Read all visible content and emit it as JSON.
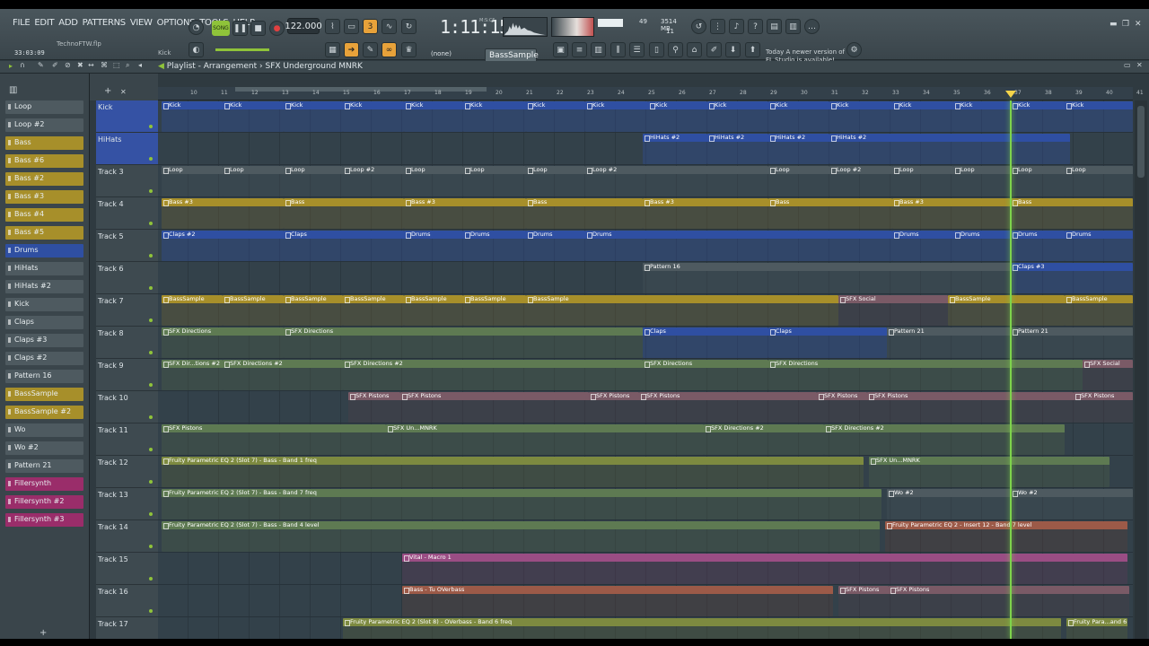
{
  "menu": [
    "FILE",
    "EDIT",
    "ADD",
    "PATTERNS",
    "VIEW",
    "OPTIONS",
    "TOOLS",
    "HELP"
  ],
  "file_name": "TechnoFTW.flp",
  "hint_label": "Kick",
  "time_elapsed": "33:03:09",
  "song_button": "SONG",
  "tempo": "122.000",
  "clock": "1:11:15",
  "clock_unit": "M:S:CS",
  "cpu_value": "49",
  "mem_value": "3514 MB",
  "poly_value": "11",
  "none_select": "(none)",
  "pattern_select": "BassSample",
  "update_hint": [
    "Today  A newer version of",
    "FL Studio is available!"
  ],
  "breadcrumb": {
    "root": "Playlist - Arrangement",
    "current": "SFX Underground MNRK"
  },
  "patterns": [
    {
      "name": "Loop",
      "color": "#4e5a60"
    },
    {
      "name": "Loop #2",
      "color": "#4e5a60"
    },
    {
      "name": "Bass",
      "color": "#a78f2a"
    },
    {
      "name": "Bass #6",
      "color": "#a78f2a"
    },
    {
      "name": "Bass #2",
      "color": "#a78f2a"
    },
    {
      "name": "Bass #3",
      "color": "#a78f2a"
    },
    {
      "name": "Bass #4",
      "color": "#a78f2a"
    },
    {
      "name": "Bass #5",
      "color": "#a78f2a"
    },
    {
      "name": "Drums",
      "color": "#2f4fa2"
    },
    {
      "name": "HiHats",
      "color": "#4e5a60"
    },
    {
      "name": "HiHats #2",
      "color": "#4e5a60"
    },
    {
      "name": "Kick",
      "color": "#4e5a60"
    },
    {
      "name": "Claps",
      "color": "#4e5a60"
    },
    {
      "name": "Claps #3",
      "color": "#4e5a60"
    },
    {
      "name": "Claps #2",
      "color": "#4e5a60"
    },
    {
      "name": "Pattern 16",
      "color": "#4e5a60"
    },
    {
      "name": "BassSample",
      "color": "#a78f2a"
    },
    {
      "name": "BassSample #2",
      "color": "#a78f2a"
    },
    {
      "name": "Wo",
      "color": "#4e5a60"
    },
    {
      "name": "Wo #2",
      "color": "#4e5a60"
    },
    {
      "name": "Pattern 21",
      "color": "#4e5a60"
    },
    {
      "name": "Fillersynth",
      "color": "#9a2d6a"
    },
    {
      "name": "Fillersynth #2",
      "color": "#9a2d6a"
    },
    {
      "name": "Fillersynth #3",
      "color": "#9a2d6a"
    }
  ],
  "ruler": [
    "10",
    "11",
    "12",
    "13",
    "14",
    "15",
    "16",
    "17",
    "18",
    "19",
    "20",
    "21",
    "22",
    "23",
    "24",
    "25",
    "26",
    "27",
    "28",
    "29",
    "30",
    "31",
    "32",
    "33",
    "34",
    "35",
    "36",
    "37",
    "38",
    "39",
    "40",
    "41"
  ],
  "tracks": [
    {
      "name": "Kick",
      "clips": [
        [
          "Kick",
          4,
          "blue"
        ],
        [
          "Kick",
          72,
          "blue"
        ],
        [
          "Kick",
          140,
          "blue"
        ],
        [
          "Kick",
          206,
          "blue"
        ],
        [
          "Kick",
          274,
          "blue"
        ],
        [
          "Kick",
          340,
          "blue"
        ],
        [
          "Kick",
          410,
          "blue"
        ],
        [
          "Kick",
          476,
          "blue"
        ],
        [
          "Kick",
          546,
          "blue"
        ],
        [
          "Kick",
          612,
          "blue"
        ],
        [
          "Kick",
          680,
          "blue"
        ],
        [
          "Kick",
          748,
          "blue"
        ],
        [
          "Kick",
          818,
          "blue"
        ],
        [
          "Kick",
          886,
          "blue"
        ],
        [
          "Kick",
          950,
          "blue"
        ],
        [
          "Kick",
          1010,
          "blue"
        ]
      ]
    },
    {
      "name": "HiHats",
      "clips": [
        [
          "HiHats #2",
          540,
          "blue"
        ],
        [
          "HiHats #2",
          612,
          "blue"
        ],
        [
          "HiHats #2",
          680,
          "blue"
        ],
        [
          "HiHats #2",
          748,
          "blue"
        ]
      ]
    },
    {
      "name": "Track 3",
      "clips": [
        [
          "Loop",
          4,
          "grey"
        ],
        [
          "Loop",
          72,
          "grey"
        ],
        [
          "Loop",
          140,
          "grey"
        ],
        [
          "Loop #2",
          206,
          "grey"
        ],
        [
          "Loop",
          274,
          "grey"
        ],
        [
          "Loop",
          340,
          "grey"
        ],
        [
          "Loop",
          410,
          "grey"
        ],
        [
          "Loop #2",
          476,
          "grey"
        ],
        [
          "Loop",
          680,
          "grey"
        ],
        [
          "Loop #2",
          748,
          "grey"
        ],
        [
          "Loop",
          818,
          "grey"
        ],
        [
          "Loop",
          886,
          "grey"
        ],
        [
          "Loop",
          950,
          "grey"
        ],
        [
          "Loop",
          1010,
          "grey"
        ]
      ]
    },
    {
      "name": "Track 4",
      "clips": [
        [
          "Bass #3",
          4,
          "gold"
        ],
        [
          "Bass",
          140,
          "gold"
        ],
        [
          "Bass #3",
          274,
          "gold"
        ],
        [
          "Bass",
          410,
          "gold"
        ],
        [
          "Bass #3",
          540,
          "gold"
        ],
        [
          "Bass",
          680,
          "gold"
        ],
        [
          "Bass #3",
          818,
          "gold"
        ],
        [
          "Bass",
          950,
          "gold"
        ]
      ]
    },
    {
      "name": "Track 5",
      "clips": [
        [
          "Claps #2",
          4,
          "blue"
        ],
        [
          "Claps",
          140,
          "blue"
        ],
        [
          "Drums",
          274,
          "blue"
        ],
        [
          "Drums",
          340,
          "blue"
        ],
        [
          "Drums",
          410,
          "blue"
        ],
        [
          "Drums",
          476,
          "blue"
        ],
        [
          "Drums",
          818,
          "blue"
        ],
        [
          "Drums",
          886,
          "blue"
        ],
        [
          "Drums",
          950,
          "blue"
        ],
        [
          "Drums",
          1010,
          "blue"
        ]
      ]
    },
    {
      "name": "Track 6",
      "clips": [
        [
          "Pattern 16",
          540,
          "grey"
        ],
        [
          "Claps #3",
          950,
          "blue"
        ]
      ]
    },
    {
      "name": "Track 7",
      "clips": [
        [
          "BassSample",
          4,
          "gold"
        ],
        [
          "BassSample",
          72,
          "gold"
        ],
        [
          "BassSample",
          140,
          "gold"
        ],
        [
          "BassSample",
          206,
          "gold"
        ],
        [
          "BassSample",
          274,
          "gold"
        ],
        [
          "BassSample",
          340,
          "gold"
        ],
        [
          "BassSample",
          410,
          "gold"
        ],
        [
          "SFX Social",
          758,
          "mauve"
        ],
        [
          "BassSample",
          880,
          "gold"
        ],
        [
          "BassSample",
          1010,
          "gold"
        ]
      ]
    },
    {
      "name": "Track 8",
      "clips": [
        [
          "SFX Directions",
          4,
          "green"
        ],
        [
          "SFX Directions",
          140,
          "green"
        ],
        [
          "Claps",
          540,
          "blue"
        ],
        [
          "Claps",
          680,
          "blue"
        ],
        [
          "Pattern 21",
          812,
          "grey"
        ],
        [
          "Pattern 21",
          950,
          "grey"
        ]
      ]
    },
    {
      "name": "Track 9",
      "clips": [
        [
          "SFX Dir...tions #2",
          4,
          "green"
        ],
        [
          "SFX Directions #2",
          72,
          "green"
        ],
        [
          "SFX Directions #2",
          206,
          "green"
        ],
        [
          "SFX Directions",
          540,
          "green"
        ],
        [
          "SFX Directions",
          680,
          "green"
        ],
        [
          "SFX Social",
          1030,
          "mauve"
        ]
      ]
    },
    {
      "name": "Track 10",
      "clips": [
        [
          "SFX Pistons",
          212,
          "mauve"
        ],
        [
          "SFX Pistons",
          270,
          "mauve"
        ],
        [
          "SFX Pistons",
          480,
          "mauve"
        ],
        [
          "SFX Pistons",
          536,
          "mauve"
        ],
        [
          "SFX Pistons",
          734,
          "mauve"
        ],
        [
          "SFX Pistons",
          790,
          "mauve"
        ],
        [
          "SFX Pistons",
          1020,
          "mauve"
        ]
      ]
    },
    {
      "name": "Track 11",
      "clips": [
        [
          "SFX Pistons",
          4,
          "green"
        ],
        [
          "SFX Un...MNRK",
          254,
          "green"
        ],
        [
          "SFX Directions #2",
          608,
          "green"
        ],
        [
          "SFX Directions #2",
          742,
          "green"
        ]
      ]
    },
    {
      "name": "Track 12",
      "clips": [
        [
          "Fruity Parametric EQ 2 (Slot 7) - Bass - Band 1 freq",
          4,
          "olive"
        ],
        [
          "SFX Un...MNRK",
          792,
          "green"
        ]
      ]
    },
    {
      "name": "Track 13",
      "clips": [
        [
          "Fruity Parametric EQ 2 (Slot 7) - Bass - Band 7 freq",
          4,
          "green"
        ],
        [
          "Wo #2",
          812,
          "grey"
        ],
        [
          "Wo #2",
          950,
          "grey"
        ]
      ]
    },
    {
      "name": "Track 14",
      "clips": [
        [
          "Fruity Parametric EQ 2 (Slot 7) - Bass - Band 4 level",
          4,
          "green"
        ],
        [
          "Fruity Parametric EQ 2 - Insert 12 - Band 7 level",
          810,
          "rust"
        ]
      ]
    },
    {
      "name": "Track 15",
      "clips": [
        [
          "Vital - Macro 1",
          272,
          "pink"
        ]
      ]
    },
    {
      "name": "Track 16",
      "clips": [
        [
          "Bass - Tu OVerbass",
          272,
          "rust"
        ],
        [
          "SFX Pistons",
          758,
          "mauve"
        ],
        [
          "SFX Pistons",
          814,
          "mauve"
        ]
      ]
    },
    {
      "name": "Track 17",
      "clips": [
        [
          "Fruity Parametric EQ 2 (Slot 8) - OVerbass - Band 6 freq",
          206,
          "olive"
        ],
        [
          "Fruity Para...and 6 freq",
          1012,
          "olive"
        ]
      ]
    }
  ]
}
